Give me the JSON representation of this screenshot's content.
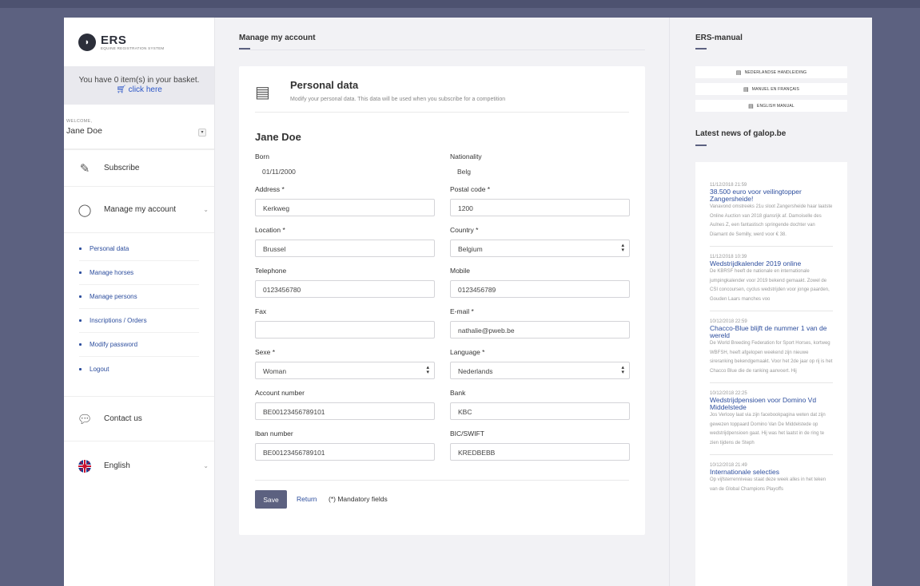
{
  "logo": {
    "name": "ERS",
    "tagline": "EQUINE REGISTRATION SYSTEM"
  },
  "basket": {
    "text": "You have 0 item(s) in your basket.",
    "link": "click here"
  },
  "user": {
    "welcome_label": "WELCOME,",
    "name": "Jane Doe"
  },
  "nav": {
    "subscribe": "Subscribe",
    "manage_account": "Manage my account",
    "sub_items": [
      "Personal data",
      "Manage horses",
      "Manage persons",
      "Inscriptions / Orders",
      "Modify password",
      "Logout"
    ],
    "contact": "Contact us",
    "language": "English"
  },
  "main": {
    "heading": "Manage my account",
    "card_title": "Personal data",
    "card_subtitle": "Modify your personal data. This data will be used when you subscribe for a competition",
    "person_name": "Jane Doe",
    "fields": {
      "born": {
        "label": "Born",
        "value": "01/11/2000"
      },
      "nationality": {
        "label": "Nationality",
        "value": "Belg"
      },
      "address": {
        "label": "Address *",
        "value": "Kerkweg"
      },
      "postal_code": {
        "label": "Postal code *",
        "value": "1200"
      },
      "location": {
        "label": "Location *",
        "value": "Brussel"
      },
      "country": {
        "label": "Country *",
        "value": "Belgium"
      },
      "telephone": {
        "label": "Telephone",
        "value": "0123456780"
      },
      "mobile": {
        "label": "Mobile",
        "value": "0123456789"
      },
      "fax": {
        "label": "Fax",
        "value": ""
      },
      "email": {
        "label": "E-mail *",
        "value": "nathalie@pweb.be"
      },
      "sexe": {
        "label": "Sexe *",
        "value": "Woman"
      },
      "language": {
        "label": "Language *",
        "value": "Nederlands"
      },
      "account_number": {
        "label": "Account number",
        "value": "BE00123456789101"
      },
      "bank": {
        "label": "Bank",
        "value": "KBC"
      },
      "iban": {
        "label": "Iban number",
        "value": "BE00123456789101"
      },
      "bic": {
        "label": "BIC/SWIFT",
        "value": "KREDBEBB"
      }
    },
    "save_label": "Save",
    "return_label": "Return",
    "mandatory_note": "(*) Mandatory fields"
  },
  "right": {
    "manual_heading": "ERS-manual",
    "manuals": [
      "NEDERLANDSE HANDLEIDING",
      "MANUEL EN FRANÇAIS",
      "ENGLISH MANUAL"
    ],
    "news_heading": "Latest news of galop.be",
    "news": [
      {
        "date": "11/12/2018 21:59",
        "title": "38.500 euro voor veilingtopper Zangersheide!",
        "text": "Vanavond omstreeks 21u sloot Zangersheide haar laatste Online Auction van 2018 glansrijk af. Damoiselle des Aulnes Z, een fantastisch springende dochter van Diamant de Semilly, werd voor € 38."
      },
      {
        "date": "11/12/2018 10:39",
        "title": "Wedstrijdkalender 2019 online",
        "text": "De KBRSF heeft de nationale en internationale jumpingkalender voor 2019 bekend gemaakt. Zowel de CSI concoursen, cyclus wedstrijden voor jonge paarden, Gouden Laars manches voo"
      },
      {
        "date": "10/12/2018 22:59",
        "title": "Chacco-Blue blijft de nummer 1 van de wereld",
        "text": "De World Breeding Federation for Sport Horses, kortweg WBFSH, heeft afgelopen weekend zijn nieuwe sireranking bekendgemaakt. Voor het 2de jaar op rij is het Chacco Blue die de ranking aanvoert. Hij"
      },
      {
        "date": "10/12/2018 22:25",
        "title": "Wedstrijdpensioen voor Domino Vd Middelstede",
        "text": "Jos Verlooy laat via zijn facebookpagina weten dat zijn gewezen toppaard Domino Van De Middelstede op wedstrijdpensioen gaat. Hij was het laatst in de ring te zien tijdens de Steph"
      },
      {
        "date": "10/12/2018 21:49",
        "title": "Internationale selecties",
        "text": "Op vijfsterrenniveau staat deze week alles in het teken van de Global Champions Playoffs"
      }
    ]
  }
}
